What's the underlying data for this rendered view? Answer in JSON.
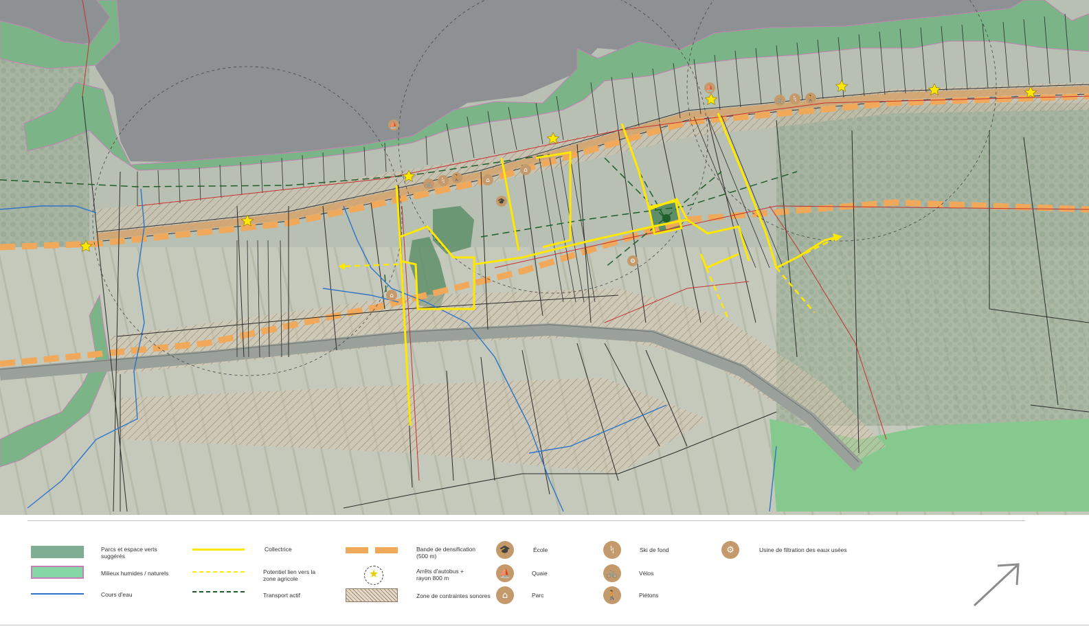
{
  "colors": {
    "parks": "#7fae93",
    "wetlands": "#86d7a6",
    "wetlands_border": "#c77fb7",
    "water": "#2d74c8",
    "collector": "#ffe800",
    "active_transport": "#1e5e2a",
    "densification": "#f0a95a",
    "icon_bg": "#c49a6c",
    "map_water": "#8f9294",
    "map_base": "#b9c0b5"
  },
  "legend": {
    "parks_label": "Parcs et espace verts suggérés",
    "wetlands_label": "Milieux humides / naturels",
    "water_label": "Cours d'eau",
    "collector_label": "Collectrice",
    "agri_link_label": "Potentiel lien vers la zone agricole",
    "active_transport_label": "Transport actif",
    "densification_label": "Bande de densification (500 m)",
    "bus_stops_label": "Arrêts d'autobus + rayon 800 m",
    "noise_label": "Zone de contraintes sonores",
    "school_label": "École",
    "dock_label": "Quaie",
    "park_label": "Parc",
    "ski_label": "Ski de fond",
    "bike_label": "Vélos",
    "pedestrian_label": "Piétons",
    "filtration_label": "Usine de filtration des eaux usées"
  },
  "icons": {
    "school": "mortarboard-icon",
    "dock": "sailboat-icon",
    "park": "bench-icon",
    "ski": "ski-icon",
    "bike": "bicycle-icon",
    "pedestrian": "pedestrian-icon",
    "filtration": "filtration-plant-icon",
    "bus_stop": "star-icon",
    "north": "north-arrow-icon"
  }
}
